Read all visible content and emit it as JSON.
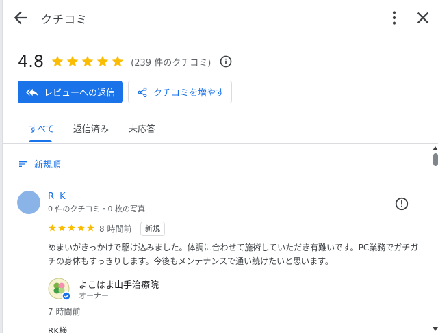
{
  "header": {
    "title": "クチコミ",
    "back_icon": "arrow-back-icon",
    "more_icon": "more-vert-icon",
    "close_icon": "close-icon"
  },
  "rating": {
    "value": "4.8",
    "stars": 5,
    "count_text": "(239 件のクチコミ)",
    "star_color": "#fbbc04"
  },
  "actions": {
    "reply_label": "レビューへの返信",
    "share_label": "クチコミを増やす",
    "accent_color": "#1a73e8"
  },
  "tabs": [
    {
      "label": "すべて",
      "active": true
    },
    {
      "label": "返信済み",
      "active": false
    },
    {
      "label": "未応答",
      "active": false
    }
  ],
  "sort": {
    "label": "新規順"
  },
  "review": {
    "name": "R K",
    "meta": "0 件のクチコミ・0 枚の写真",
    "stars": 5,
    "time": "8 時間前",
    "badge": "新規",
    "text": "めまいがきっかけで駆け込みました。体調に合わせて施術していただき有難いです。PC業務でガチガチの身体もすっきりします。今後もメンテナンスで通い続けたいと思います。"
  },
  "owner_reply": {
    "name": "よこはま山手治療院",
    "role": "オーナー",
    "time": "7 時間前",
    "text": "RK様"
  }
}
